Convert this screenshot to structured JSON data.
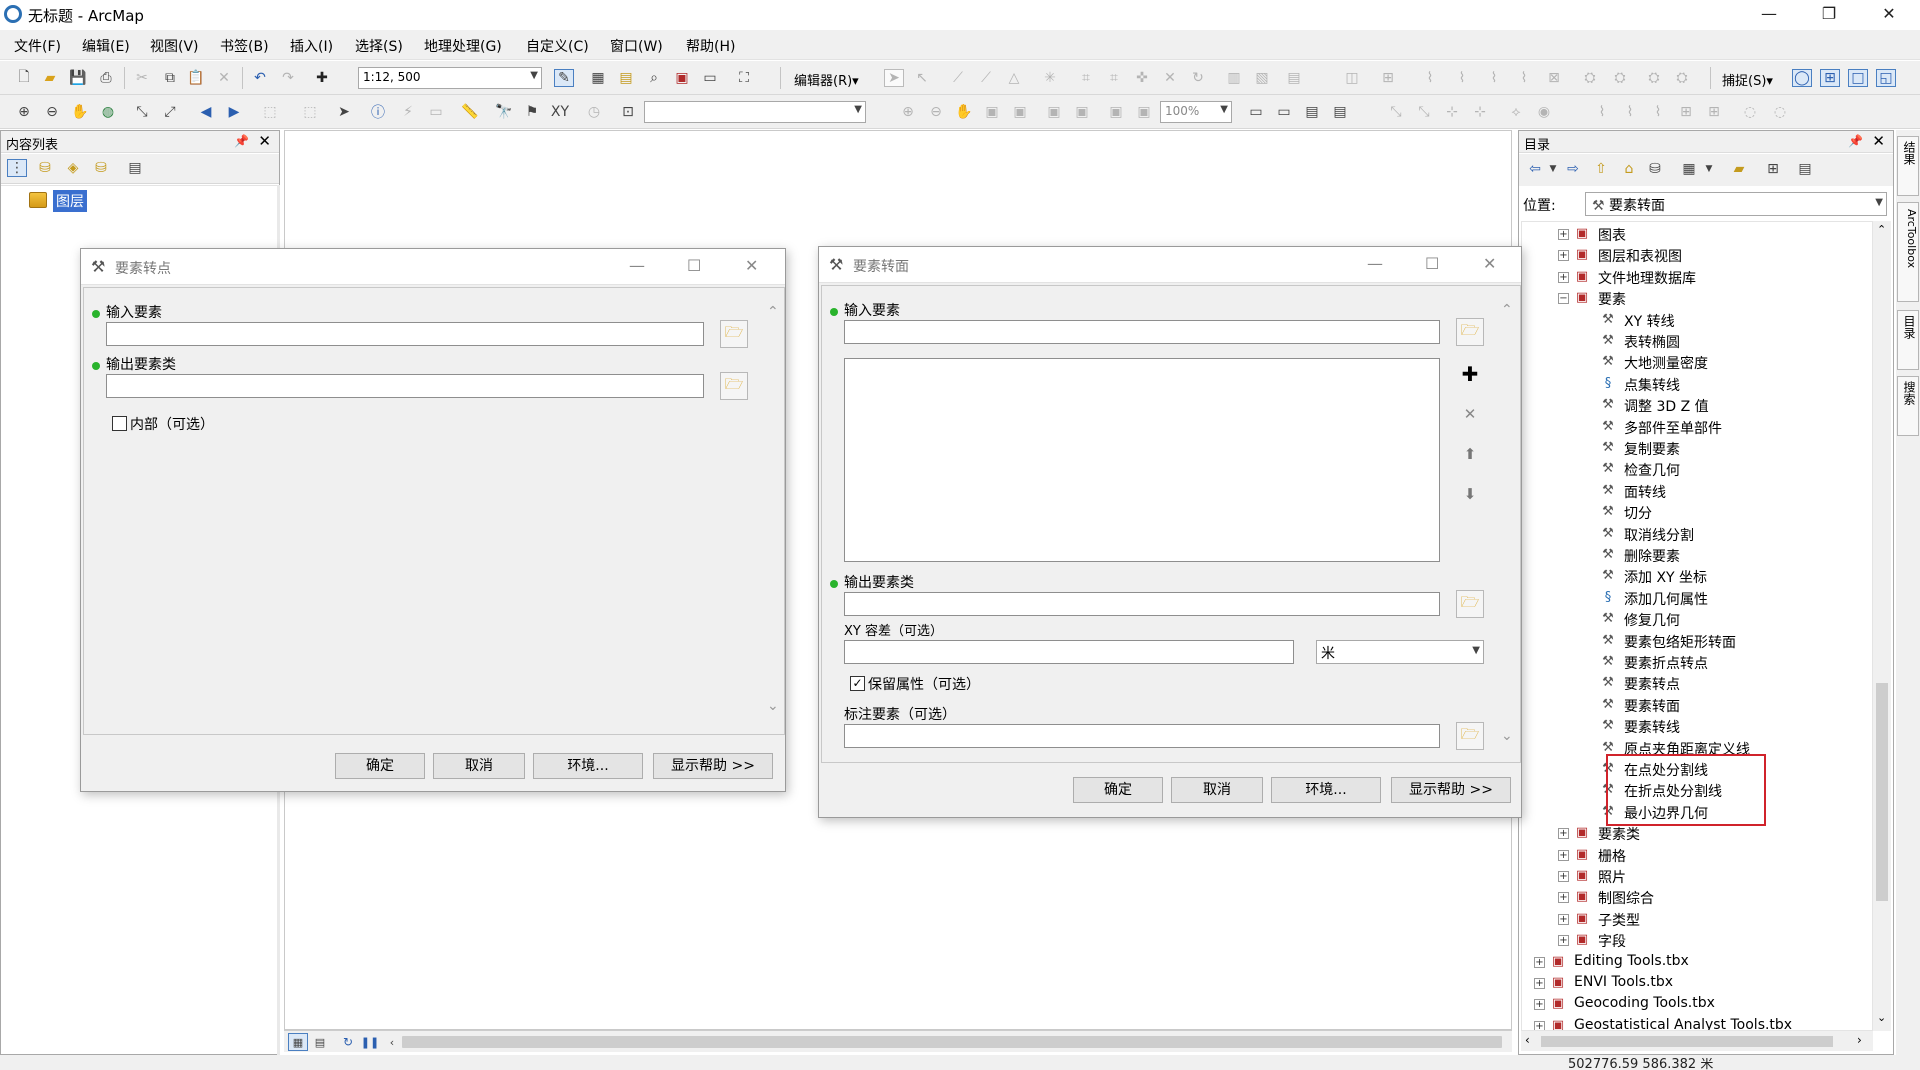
{
  "window": {
    "title": "无标题 - ArcMap"
  },
  "menu": [
    "文件(F)",
    "编辑(E)",
    "视图(V)",
    "书签(B)",
    "插入(I)",
    "选择(S)",
    "地理处理(G)",
    "自定义(C)",
    "窗口(W)",
    "帮助(H)"
  ],
  "toolbar": {
    "scale": "1:12, 500",
    "editor": "编辑器(R)▾",
    "zoom": "100%",
    "snapping": "捕捉(S)▾"
  },
  "toc": {
    "title": "内容列表",
    "layers_label": "图层"
  },
  "catalog": {
    "title": "目录",
    "location_label": "位置:",
    "location_value": "要素转面",
    "items": [
      {
        "label": "图表",
        "kind": "toolset",
        "level": 1,
        "expand": "+"
      },
      {
        "label": "图层和表视图",
        "kind": "toolset",
        "level": 1,
        "expand": "+"
      },
      {
        "label": "文件地理数据库",
        "kind": "toolset",
        "level": 1,
        "expand": "+"
      },
      {
        "label": "要素",
        "kind": "toolset",
        "level": 1,
        "expand": "−"
      },
      {
        "label": "XY 转线",
        "kind": "tool",
        "level": 2
      },
      {
        "label": "表转椭圆",
        "kind": "tool",
        "level": 2
      },
      {
        "label": "大地测量密度",
        "kind": "tool",
        "level": 2
      },
      {
        "label": "点集转线",
        "kind": "script",
        "level": 2
      },
      {
        "label": "调整 3D Z 值",
        "kind": "tool",
        "level": 2
      },
      {
        "label": "多部件至单部件",
        "kind": "tool",
        "level": 2
      },
      {
        "label": "复制要素",
        "kind": "tool",
        "level": 2
      },
      {
        "label": "检查几何",
        "kind": "tool",
        "level": 2
      },
      {
        "label": "面转线",
        "kind": "tool",
        "level": 2
      },
      {
        "label": "切分",
        "kind": "tool",
        "level": 2
      },
      {
        "label": "取消线分割",
        "kind": "tool",
        "level": 2
      },
      {
        "label": "删除要素",
        "kind": "tool",
        "level": 2
      },
      {
        "label": "添加 XY 坐标",
        "kind": "tool",
        "level": 2
      },
      {
        "label": "添加几何属性",
        "kind": "script",
        "level": 2
      },
      {
        "label": "修复几何",
        "kind": "tool",
        "level": 2
      },
      {
        "label": "要素包络矩形转面",
        "kind": "tool",
        "level": 2
      },
      {
        "label": "要素折点转点",
        "kind": "tool",
        "level": 2
      },
      {
        "label": "要素转点",
        "kind": "tool",
        "level": 2
      },
      {
        "label": "要素转面",
        "kind": "tool",
        "level": 2
      },
      {
        "label": "要素转线",
        "kind": "tool",
        "level": 2
      },
      {
        "label": "原点夹角距离定义线",
        "kind": "tool",
        "level": 2
      },
      {
        "label": "在点处分割线",
        "kind": "tool",
        "level": 2
      },
      {
        "label": "在折点处分割线",
        "kind": "tool",
        "level": 2
      },
      {
        "label": "最小边界几何",
        "kind": "tool",
        "level": 2
      },
      {
        "label": "要素类",
        "kind": "toolset",
        "level": 1,
        "expand": "+"
      },
      {
        "label": "栅格",
        "kind": "toolset",
        "level": 1,
        "expand": "+"
      },
      {
        "label": "照片",
        "kind": "toolset",
        "level": 1,
        "expand": "+"
      },
      {
        "label": "制图综合",
        "kind": "toolset",
        "level": 1,
        "expand": "+"
      },
      {
        "label": "子类型",
        "kind": "toolset",
        "level": 1,
        "expand": "+"
      },
      {
        "label": "字段",
        "kind": "toolset",
        "level": 1,
        "expand": "+"
      },
      {
        "label": "Editing Tools.tbx",
        "kind": "toolbox",
        "level": 0,
        "expand": "+"
      },
      {
        "label": "ENVI Tools.tbx",
        "kind": "toolbox",
        "level": 0,
        "expand": "+"
      },
      {
        "label": "Geocoding Tools.tbx",
        "kind": "toolbox",
        "level": 0,
        "expand": "+"
      },
      {
        "label": "Geostatistical Analyst Tools.tbx",
        "kind": "toolbox",
        "level": 0,
        "expand": "+"
      }
    ]
  },
  "side_tabs": [
    "结果",
    "ArcToolbox",
    "目录",
    "搜索"
  ],
  "dialog1": {
    "title": "要素转点",
    "input_label": "输入要素",
    "output_label": "输出要素类",
    "inside_label": "内部（可选）",
    "ok": "确定",
    "cancel": "取消",
    "env": "环境...",
    "help": "显示帮助 >>"
  },
  "dialog2": {
    "title": "要素转面",
    "input_label": "输入要素",
    "output_label": "输出要素类",
    "xy_label": "XY 容差（可选）",
    "unit": "米",
    "keep_label": "保留属性（可选）",
    "keep_checked": "✓",
    "label_features": "标注要素（可选）",
    "ok": "确定",
    "cancel": "取消",
    "env": "环境...",
    "help": "显示帮助 >>"
  },
  "status": {
    "coords": "502776.59  586.382 米"
  },
  "colors": {
    "highlight_box": "#d0232b",
    "required_dot": "#29b32c",
    "selected_layer": "#3a6fcf"
  }
}
